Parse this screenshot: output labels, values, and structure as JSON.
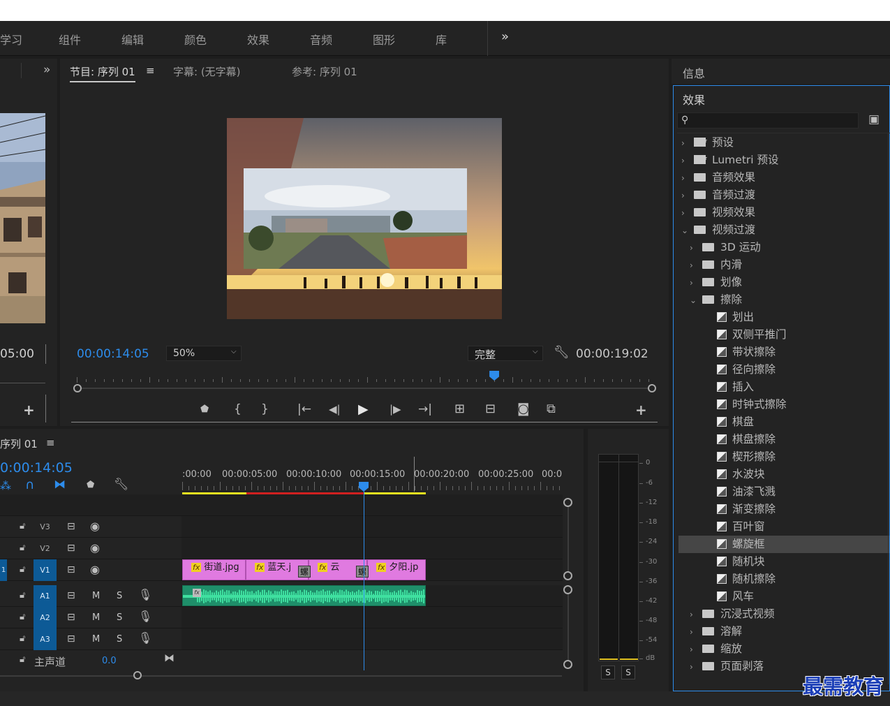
{
  "menu": {
    "items": [
      "学习",
      "组件",
      "编辑",
      "颜色",
      "效果",
      "音频",
      "图形",
      "库"
    ],
    "more": "»"
  },
  "source": {
    "more": "»",
    "timecode": "05:00",
    "add": "+"
  },
  "program": {
    "tabs": [
      "节目: 序列 01",
      "字幕: (无字幕)",
      "参考: 序列 01"
    ],
    "tab_menu": "≡",
    "timecode": "00:00:14:05",
    "zoom": "50%",
    "quality": "完整",
    "duration": "00:00:19:02",
    "playhead": 0.725,
    "add": "+"
  },
  "timeline": {
    "tab": "序列 01",
    "tab_menu": "≡",
    "timecode": "0:00:14:05",
    "ruler": [
      ":00:00",
      "00:00:05:00",
      "00:00:10:00",
      "00:00:15:00",
      "00:00:20:00",
      "00:00:25:00",
      "00:0"
    ],
    "tracks": [
      {
        "id": "V3",
        "type": "video"
      },
      {
        "id": "V2",
        "type": "video"
      },
      {
        "id": "V1",
        "type": "video",
        "target": "1"
      },
      {
        "id": "A1",
        "type": "audio",
        "m": "M",
        "s": "S"
      },
      {
        "id": "A2",
        "type": "audio",
        "m": "M",
        "s": "S"
      },
      {
        "id": "A3",
        "type": "audio",
        "m": "M",
        "s": "S"
      }
    ],
    "clips": [
      {
        "fx": "fx",
        "name": "街道.jpg"
      },
      {
        "fx": "fx",
        "name": "蓝天.j"
      },
      {
        "fx": "fx",
        "name": "云"
      },
      {
        "fx": "fx",
        "name": "夕阳.jp"
      }
    ],
    "transitions": [
      "螺",
      "螺"
    ],
    "master": {
      "label": "主声道",
      "value": "0.0"
    }
  },
  "audio_meter": {
    "scale": [
      "0",
      "-6",
      "-12",
      "-18",
      "-24",
      "-30",
      "-36",
      "-42",
      "-48",
      "-54",
      "dB"
    ],
    "solo": [
      "S",
      "S"
    ]
  },
  "info": {
    "title": "信息"
  },
  "effects": {
    "title": "效果",
    "items": [
      {
        "label": "预设",
        "kind": "preset",
        "level": 0,
        "open": false
      },
      {
        "label": "Lumetri 预设",
        "kind": "preset",
        "level": 0,
        "open": false
      },
      {
        "label": "音频效果",
        "kind": "folder",
        "level": 0,
        "open": false
      },
      {
        "label": "音频过渡",
        "kind": "folder",
        "level": 0,
        "open": false
      },
      {
        "label": "视频效果",
        "kind": "folder",
        "level": 0,
        "open": false
      },
      {
        "label": "视频过渡",
        "kind": "folder",
        "level": 0,
        "open": true
      },
      {
        "label": "3D 运动",
        "kind": "folder",
        "level": 1,
        "open": false
      },
      {
        "label": "内滑",
        "kind": "folder",
        "level": 1,
        "open": false
      },
      {
        "label": "划像",
        "kind": "folder",
        "level": 1,
        "open": false
      },
      {
        "label": "擦除",
        "kind": "folder",
        "level": 1,
        "open": true
      },
      {
        "label": "划出",
        "kind": "item",
        "level": 2
      },
      {
        "label": "双侧平推门",
        "kind": "item",
        "level": 2
      },
      {
        "label": "带状擦除",
        "kind": "item",
        "level": 2
      },
      {
        "label": "径向擦除",
        "kind": "item",
        "level": 2
      },
      {
        "label": "插入",
        "kind": "item",
        "level": 2
      },
      {
        "label": "时钟式擦除",
        "kind": "item",
        "level": 2
      },
      {
        "label": "棋盘",
        "kind": "item",
        "level": 2
      },
      {
        "label": "棋盘擦除",
        "kind": "item",
        "level": 2
      },
      {
        "label": "楔形擦除",
        "kind": "item",
        "level": 2
      },
      {
        "label": "水波块",
        "kind": "item",
        "level": 2
      },
      {
        "label": "油漆飞溅",
        "kind": "item",
        "level": 2
      },
      {
        "label": "渐变擦除",
        "kind": "item",
        "level": 2
      },
      {
        "label": "百叶窗",
        "kind": "item",
        "level": 2
      },
      {
        "label": "螺旋框",
        "kind": "item",
        "level": 2,
        "selected": true
      },
      {
        "label": "随机块",
        "kind": "item",
        "level": 2
      },
      {
        "label": "随机擦除",
        "kind": "item",
        "level": 2
      },
      {
        "label": "风车",
        "kind": "item",
        "level": 2
      },
      {
        "label": "沉浸式视频",
        "kind": "folder",
        "level": 1,
        "open": false
      },
      {
        "label": "溶解",
        "kind": "folder",
        "level": 1,
        "open": false
      },
      {
        "label": "缩放",
        "kind": "folder",
        "level": 1,
        "open": false
      },
      {
        "label": "页面剥落",
        "kind": "folder",
        "level": 1,
        "open": false
      }
    ]
  },
  "watermark": "最需教育",
  "colors": {
    "accent": "#2d8ceb",
    "clip": "#e07ae0",
    "audio": "#2fc28a",
    "playhead": "#2d8ceb"
  }
}
